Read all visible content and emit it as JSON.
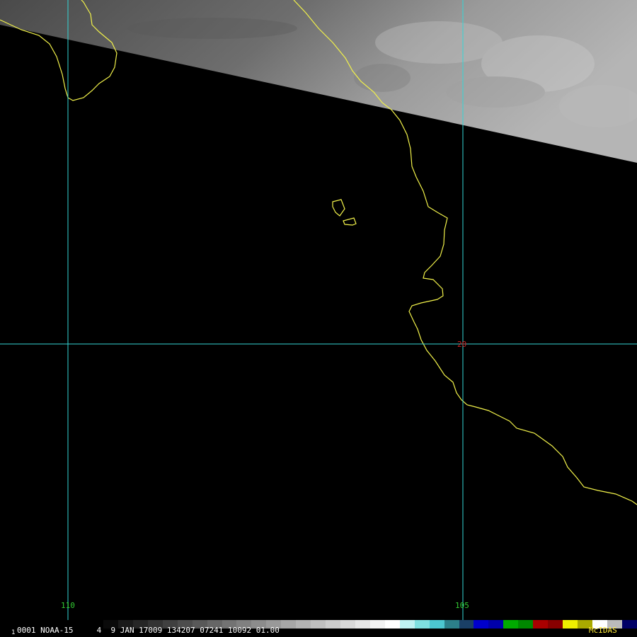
{
  "map": {
    "grid_labels": {
      "lon_110": "110",
      "lon_105": "105",
      "lat_20": "20"
    },
    "colors": {
      "grid": "#33d6d6",
      "coast": "#f2f24a",
      "lon_label": "#33cc33",
      "lat_label": "#cc2222",
      "land_swath": "#8a8a8a",
      "background": "#000000"
    }
  },
  "footer": {
    "frame_prefix": "1",
    "line": "0001 NOAA-15     4  9 JAN 17009 134207 07241 10092 01.00",
    "brand": "McIDAS",
    "colorbar": [
      "#0a0a0a",
      "#1a1a1a",
      "#262626",
      "#333333",
      "#404040",
      "#4d4d4d",
      "#595959",
      "#666666",
      "#737373",
      "#808080",
      "#8c8c8c",
      "#999999",
      "#a6a6a6",
      "#b3b3b3",
      "#bfbfbf",
      "#cccccc",
      "#d9d9d9",
      "#e6e6e6",
      "#f2f2f2",
      "#ffffff",
      "#bff2f2",
      "#7fe0e0",
      "#4cc6d0",
      "#2c7f8a",
      "#1a3f66",
      "#0000cc",
      "#0000aa",
      "#00aa00",
      "#008800",
      "#aa0000",
      "#880000",
      "#eeee00",
      "#aaaa00",
      "#ffffff",
      "#bbbbbb",
      "#000066"
    ]
  }
}
